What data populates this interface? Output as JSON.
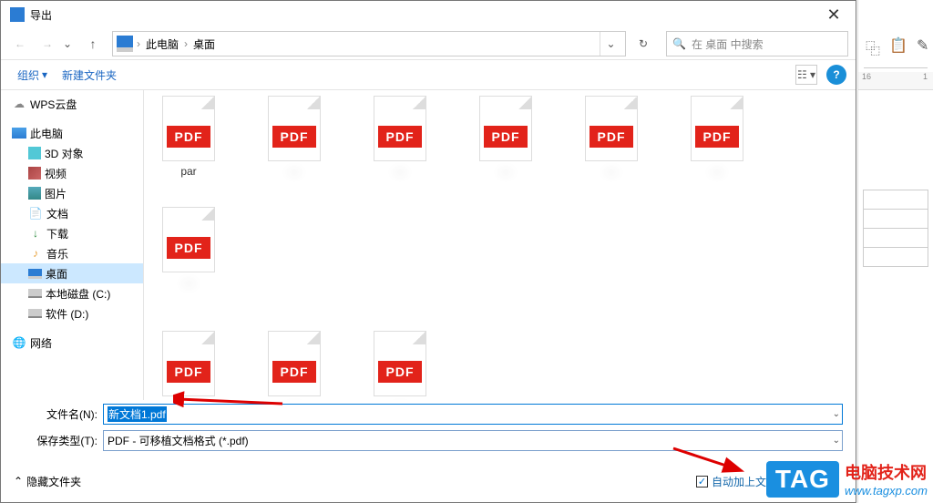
{
  "dialog": {
    "title": "导出",
    "close": "✕"
  },
  "nav": {
    "back": "←",
    "fwd": "→",
    "up": "↑",
    "refresh": "↻"
  },
  "address": {
    "seg1": "此电脑",
    "seg2": "桌面",
    "dropdown": "⌄"
  },
  "search": {
    "placeholder": "在 桌面 中搜索",
    "icon": "🔍"
  },
  "toolbar": {
    "organize": "组织",
    "newfolder": "新建文件夹",
    "help": "?"
  },
  "sidebar": {
    "items": [
      {
        "label": "WPS云盘",
        "iconClass": "i-cloud",
        "glyph": "☁"
      },
      {
        "label": "此电脑",
        "iconClass": "i-pc",
        "glyph": ""
      },
      {
        "label": "3D 对象",
        "iconClass": "i-3d",
        "glyph": "",
        "indent": true
      },
      {
        "label": "视频",
        "iconClass": "i-video",
        "glyph": "",
        "indent": true
      },
      {
        "label": "图片",
        "iconClass": "i-pic",
        "glyph": "",
        "indent": true
      },
      {
        "label": "文档",
        "iconClass": "i-doc",
        "glyph": "📄",
        "indent": true
      },
      {
        "label": "下载",
        "iconClass": "i-dl",
        "glyph": "↓",
        "indent": true
      },
      {
        "label": "音乐",
        "iconClass": "i-music",
        "glyph": "♪",
        "indent": true
      },
      {
        "label": "桌面",
        "iconClass": "i-desk",
        "glyph": "",
        "indent": true,
        "selected": true
      },
      {
        "label": "本地磁盘 (C:)",
        "iconClass": "i-drive",
        "glyph": "",
        "indent": true
      },
      {
        "label": "软件 (D:)",
        "iconClass": "i-drive",
        "glyph": "",
        "indent": true
      },
      {
        "label": "网络",
        "iconClass": "i-net",
        "glyph": "🌐"
      }
    ]
  },
  "files": {
    "badge": "PDF",
    "row1": [
      {
        "label": "par"
      },
      {
        "label": ""
      },
      {
        "label": ""
      },
      {
        "label": ""
      },
      {
        "label": ""
      },
      {
        "label": ""
      },
      {
        "label": ""
      }
    ],
    "row2": [
      {
        "label": ""
      },
      {
        "label": ""
      },
      {
        "label": ""
      }
    ]
  },
  "form": {
    "filename_label": "文件名(N):",
    "filename_value": "新文档1.pdf",
    "filetype_label": "保存类型(T):",
    "filetype_value": "PDF - 可移植文档格式 (*.pdf)"
  },
  "footer": {
    "hide": "隐藏文件夹",
    "autoext": "自动加上文档扩展名(A)",
    "check": "✓"
  },
  "watermark": {
    "tag": "TAG",
    "cn": "电脑技术网",
    "url": "www.tagxp.com"
  },
  "ruler": {
    "tick16": "16",
    "tick1": "1"
  }
}
